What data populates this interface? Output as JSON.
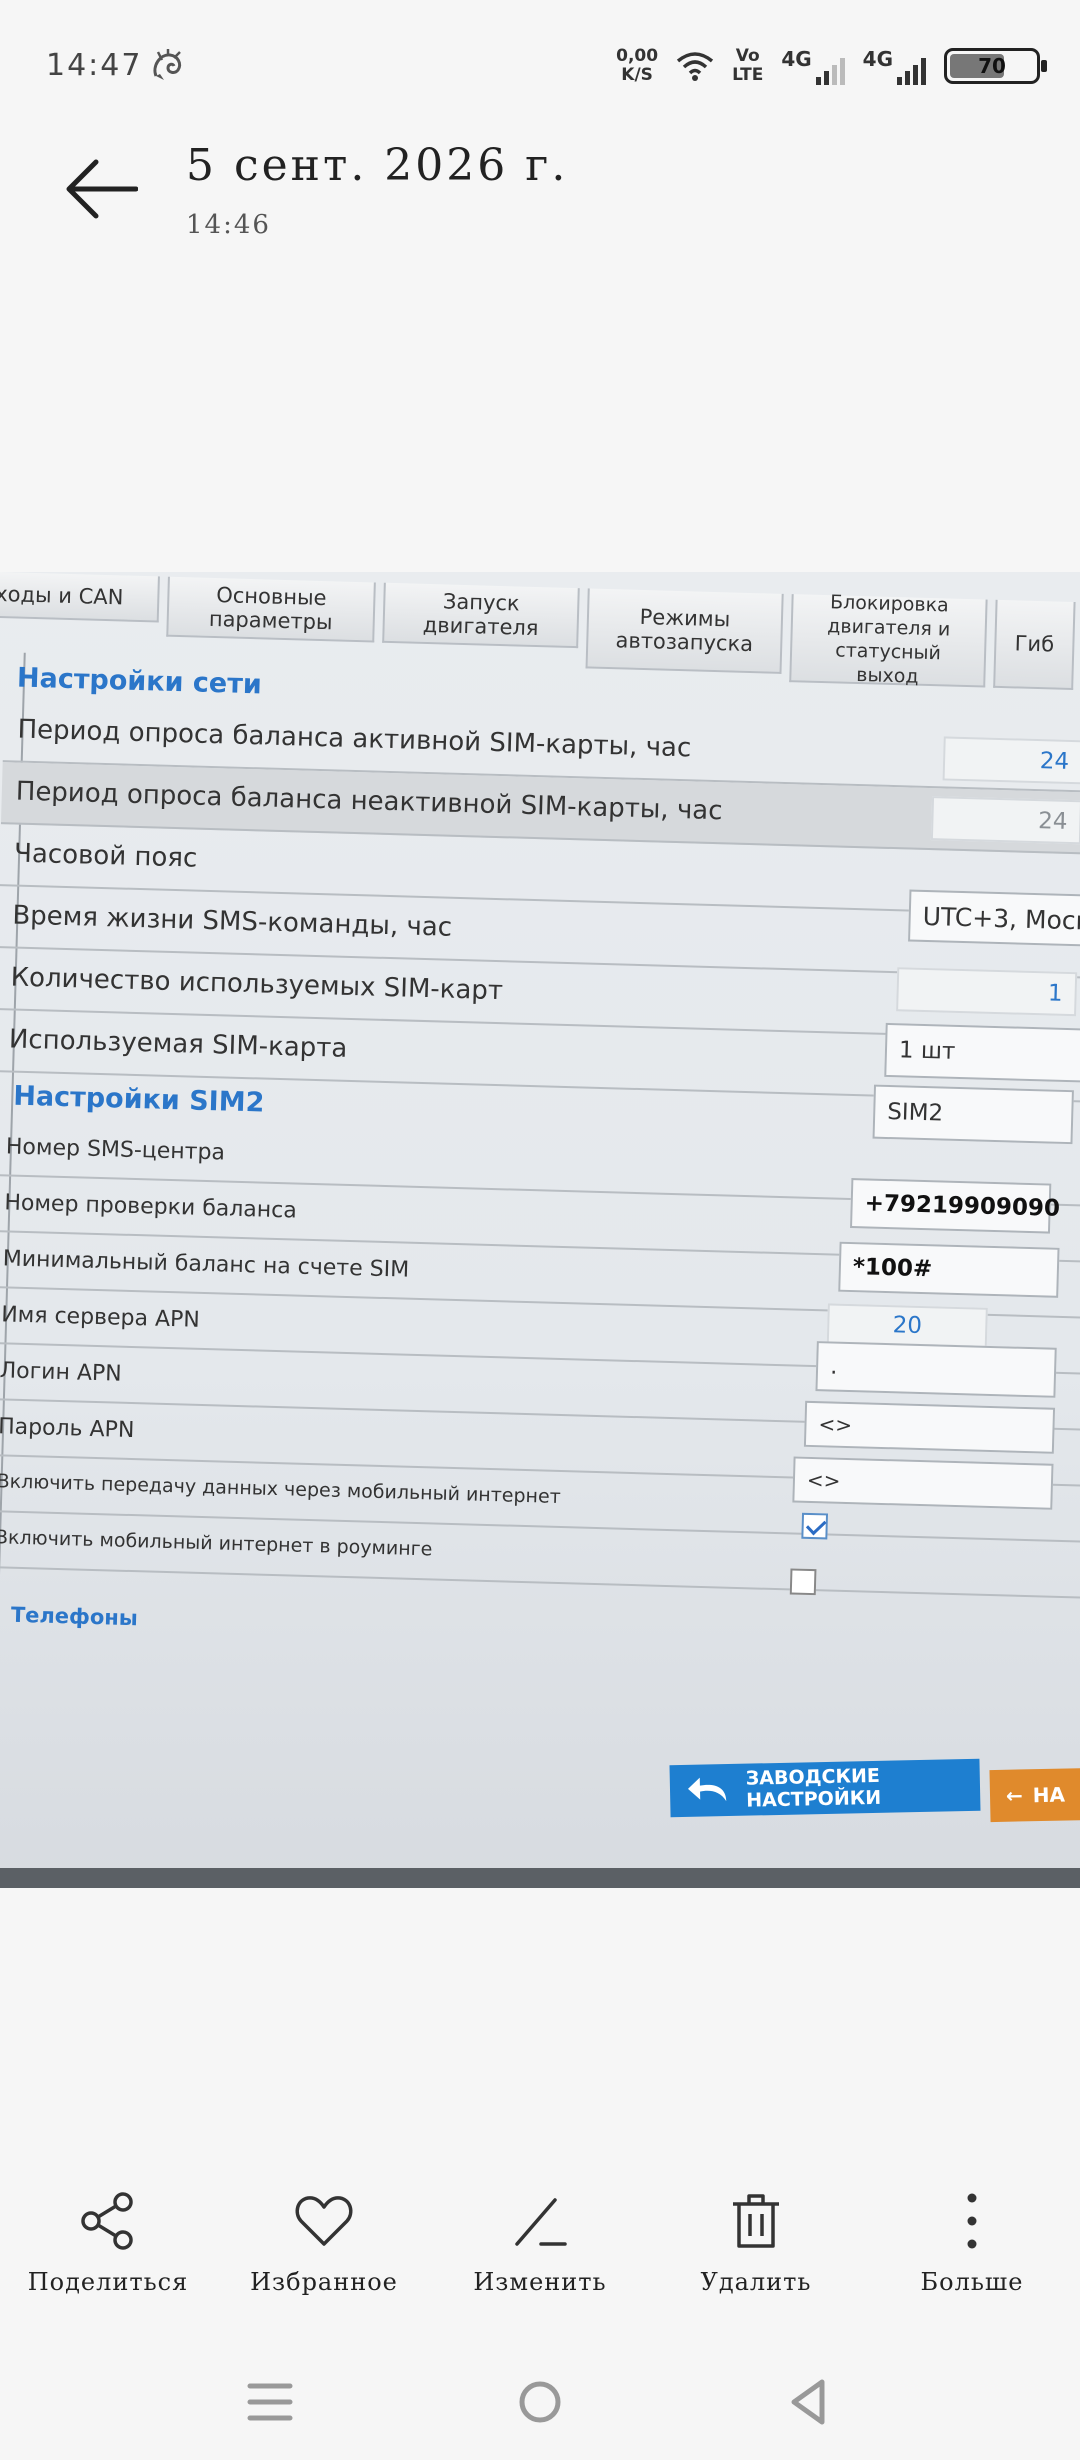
{
  "status_bar": {
    "time": "14:47",
    "speed_value": "0,00",
    "speed_unit": "K/S",
    "volte_top": "Vo",
    "volte_bottom": "LTE",
    "net1": "4G",
    "net2": "4G",
    "battery": "70",
    "icons": [
      "dragon-icon",
      "wifi-icon",
      "signal-icon",
      "battery-icon"
    ]
  },
  "header": {
    "title": "5 сент. 2026 г.",
    "subtitle": "14:46"
  },
  "photo": {
    "tabs": [
      "ходы и CAN",
      "Основные параметры",
      "Запуск двигателя",
      "Режимы автозапуска",
      "Блокировка двигателя и статусный выход",
      "Гиб"
    ],
    "network_section": {
      "title": "Настройки сети",
      "rows": [
        {
          "label": "Период опроса баланса активной SIM-карты, час",
          "value": "24"
        },
        {
          "label": "Период опроса баланса неактивной SIM-карты, час",
          "value": "24"
        },
        {
          "label": "Часовой пояс",
          "value": "UTC+3, Моск"
        },
        {
          "label": "Время жизни SMS-команды, час",
          "value": "1"
        },
        {
          "label": "Количество используемых SIM-карт",
          "value": "1 шт"
        },
        {
          "label": "Используемая SIM-карта",
          "value": "SIM2"
        }
      ]
    },
    "sim2_section": {
      "title": "Настройки SIM2",
      "rows": [
        {
          "label": "Номер SMS-центра",
          "value": "+79219909090"
        },
        {
          "label": "Номер проверки баланса",
          "value": "*100#"
        },
        {
          "label": "Минимальный баланс на счете SIM",
          "value": "20"
        },
        {
          "label": "Имя сервера APN",
          "value": "."
        },
        {
          "label": "Логин APN",
          "value": "<>"
        },
        {
          "label": "Пароль APN",
          "value": "<>"
        },
        {
          "label": "Включить передачу данных через мобильный интернет",
          "checked": true
        },
        {
          "label": "Включить мобильный интернет в роуминге",
          "checked": false
        }
      ]
    },
    "phones_section": {
      "title": "Телефоны"
    },
    "factory_button": {
      "line1": "ЗАВОДСКИЕ",
      "line2": "НАСТРОЙКИ"
    },
    "next_button": "НА"
  },
  "actions": {
    "share": "Поделиться",
    "favorite": "Избранное",
    "edit": "Изменить",
    "delete": "Удалить",
    "more": "Больше"
  },
  "colors": {
    "background": "#f6f6f6",
    "section_blue": "#2b76c9",
    "factory_button": "#1e7fd0",
    "next_button": "#e08a2c"
  }
}
